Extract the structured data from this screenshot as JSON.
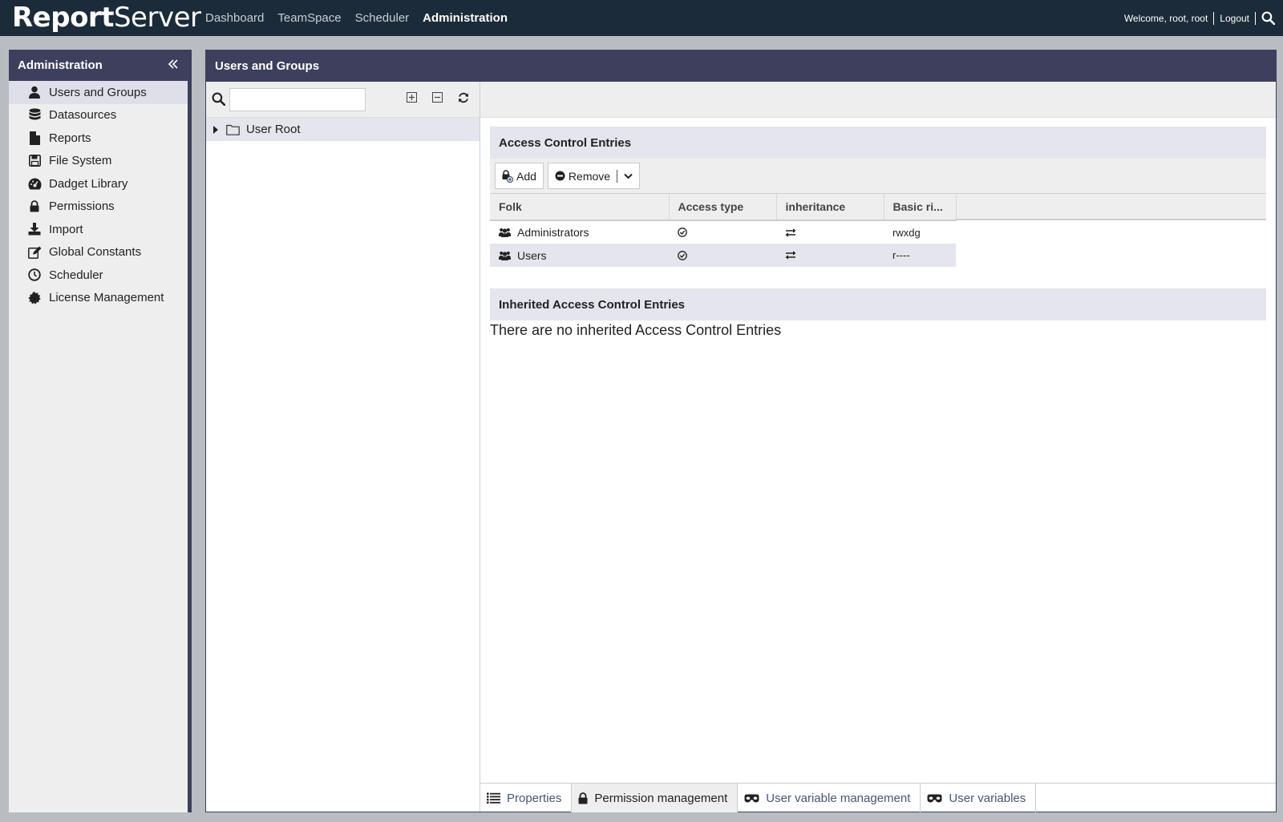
{
  "topbar": {
    "logo_part1": "Report",
    "logo_part2": "Server",
    "nav": [
      "Dashboard",
      "TeamSpace",
      "Scheduler",
      "Administration"
    ],
    "active_nav": "Administration",
    "welcome": "Welcome, root, root",
    "logout": "Logout"
  },
  "sidebar": {
    "title": "Administration",
    "items": [
      {
        "label": "Users and Groups",
        "icon": "user-icon"
      },
      {
        "label": "Datasources",
        "icon": "database-icon"
      },
      {
        "label": "Reports",
        "icon": "file-icon"
      },
      {
        "label": "File System",
        "icon": "floppy-icon"
      },
      {
        "label": "Dadget Library",
        "icon": "dashboard-icon"
      },
      {
        "label": "Permissions",
        "icon": "lock-icon"
      },
      {
        "label": "Import",
        "icon": "download-icon"
      },
      {
        "label": "Global Constants",
        "icon": "edit-icon"
      },
      {
        "label": "Scheduler",
        "icon": "clock-icon"
      },
      {
        "label": "License Management",
        "icon": "certificate-icon"
      }
    ]
  },
  "main": {
    "title": "Users and Groups",
    "tree": {
      "search_value": "",
      "root_label": "User Root"
    },
    "ace": {
      "title": "Access Control Entries",
      "add_label": "Add",
      "remove_label": "Remove",
      "columns": [
        "Folk",
        "Access type",
        "inheritance",
        "Basic ri..."
      ],
      "rows": [
        {
          "folk": "Administrators",
          "rights": "rwxdg"
        },
        {
          "folk": "Users",
          "rights": "r----"
        }
      ]
    },
    "inherited": {
      "title": "Inherited Access Control Entries",
      "empty_text": "There are no inherited Access Control Entries"
    },
    "tabs": [
      {
        "label": "Properties",
        "icon": "list-icon"
      },
      {
        "label": "Permission management",
        "icon": "lock-icon"
      },
      {
        "label": "User variable management",
        "icon": "mask-icon"
      },
      {
        "label": "User variables",
        "icon": "mask-icon"
      }
    ],
    "active_tab": "Permission management"
  },
  "colors": {
    "topbar": "#1b2b39",
    "panel_header": "#3d3f5d",
    "selection": "#e4e5ed",
    "tab_text": "#4a5576"
  }
}
